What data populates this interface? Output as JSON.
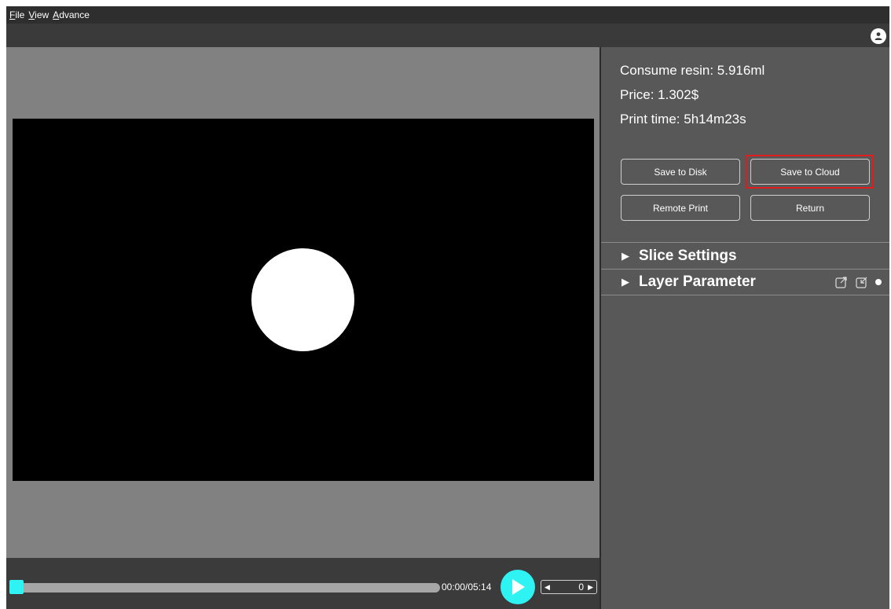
{
  "menu": {
    "file": {
      "accel": "F",
      "rest": "ile"
    },
    "view": {
      "accel": "V",
      "rest": "iew"
    },
    "advance": {
      "accel": "A",
      "rest": "dvance"
    }
  },
  "toolbar": {
    "user_icon": "user-icon"
  },
  "viewer": {
    "canvas_bg": "#000000",
    "circle_color": "#ffffff"
  },
  "playback": {
    "time": "00:00/05:14",
    "progress": 0,
    "layer_value": "0",
    "accent": "#2ff3f2"
  },
  "summary": {
    "resin": "Consume resin: 5.916ml",
    "price": "Price: 1.302$",
    "print_time": "Print time: 5h14m23s"
  },
  "buttons": {
    "save_disk": "Save to Disk",
    "save_cloud": "Save to Cloud",
    "remote_print": "Remote Print",
    "return": "Return"
  },
  "sections": {
    "slice_settings": "Slice Settings",
    "layer_parameter": "Layer Parameter"
  },
  "colors": {
    "highlight": "#e21c1c",
    "panel_bg": "#585858",
    "viewer_bg": "#808180"
  }
}
